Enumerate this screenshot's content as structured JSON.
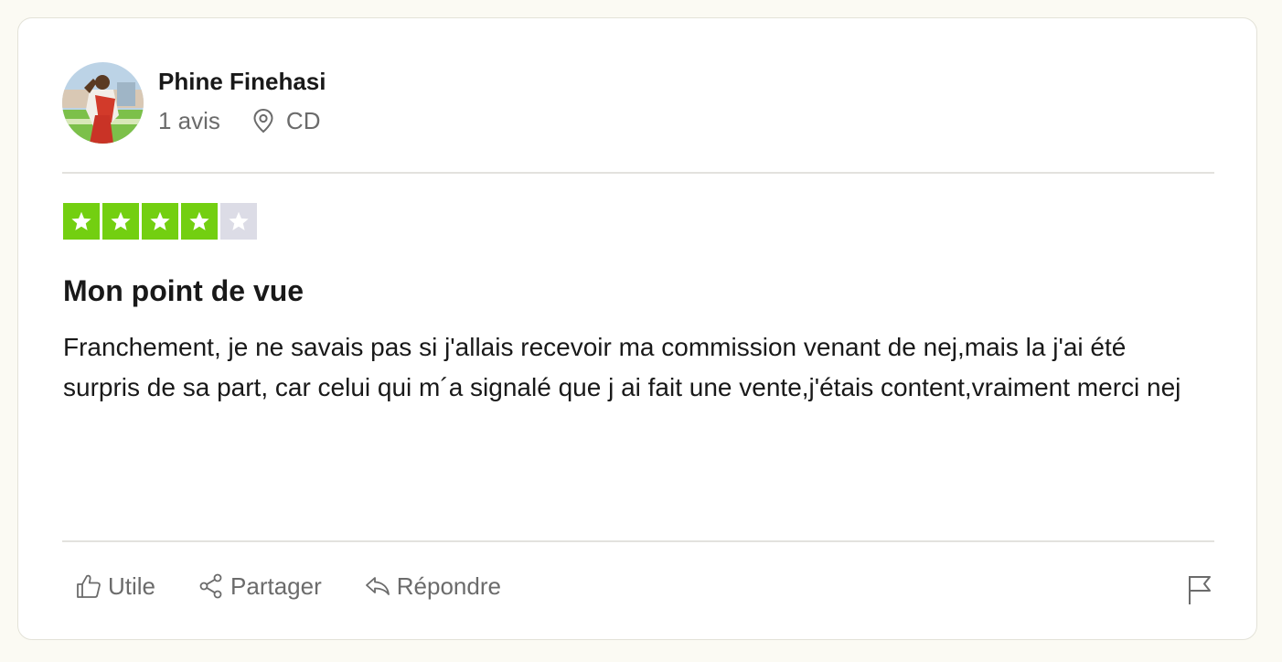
{
  "consumer": {
    "name": "Phine Finehasi",
    "reviews_count": "1 avis",
    "country": "CD"
  },
  "rating": {
    "value": 4,
    "max": 5,
    "filled_color": "#73cf11",
    "empty_color": "#dcdce6"
  },
  "review": {
    "title": "Mon point de vue",
    "body": "Franchement, je ne savais pas si j'allais recevoir ma commission venant de nej,mais la j'ai été surpris de sa part, car celui qui m´a signalé que j ai fait une vente,j'étais content,vraiment merci nej"
  },
  "actions": {
    "useful_label": "Utile",
    "share_label": "Partager",
    "reply_label": "Répondre"
  },
  "icons": {
    "location": "location-pin-icon",
    "useful": "thumbs-up-icon",
    "share": "share-icon",
    "reply": "reply-icon",
    "report": "flag-icon",
    "star": "star-icon"
  }
}
